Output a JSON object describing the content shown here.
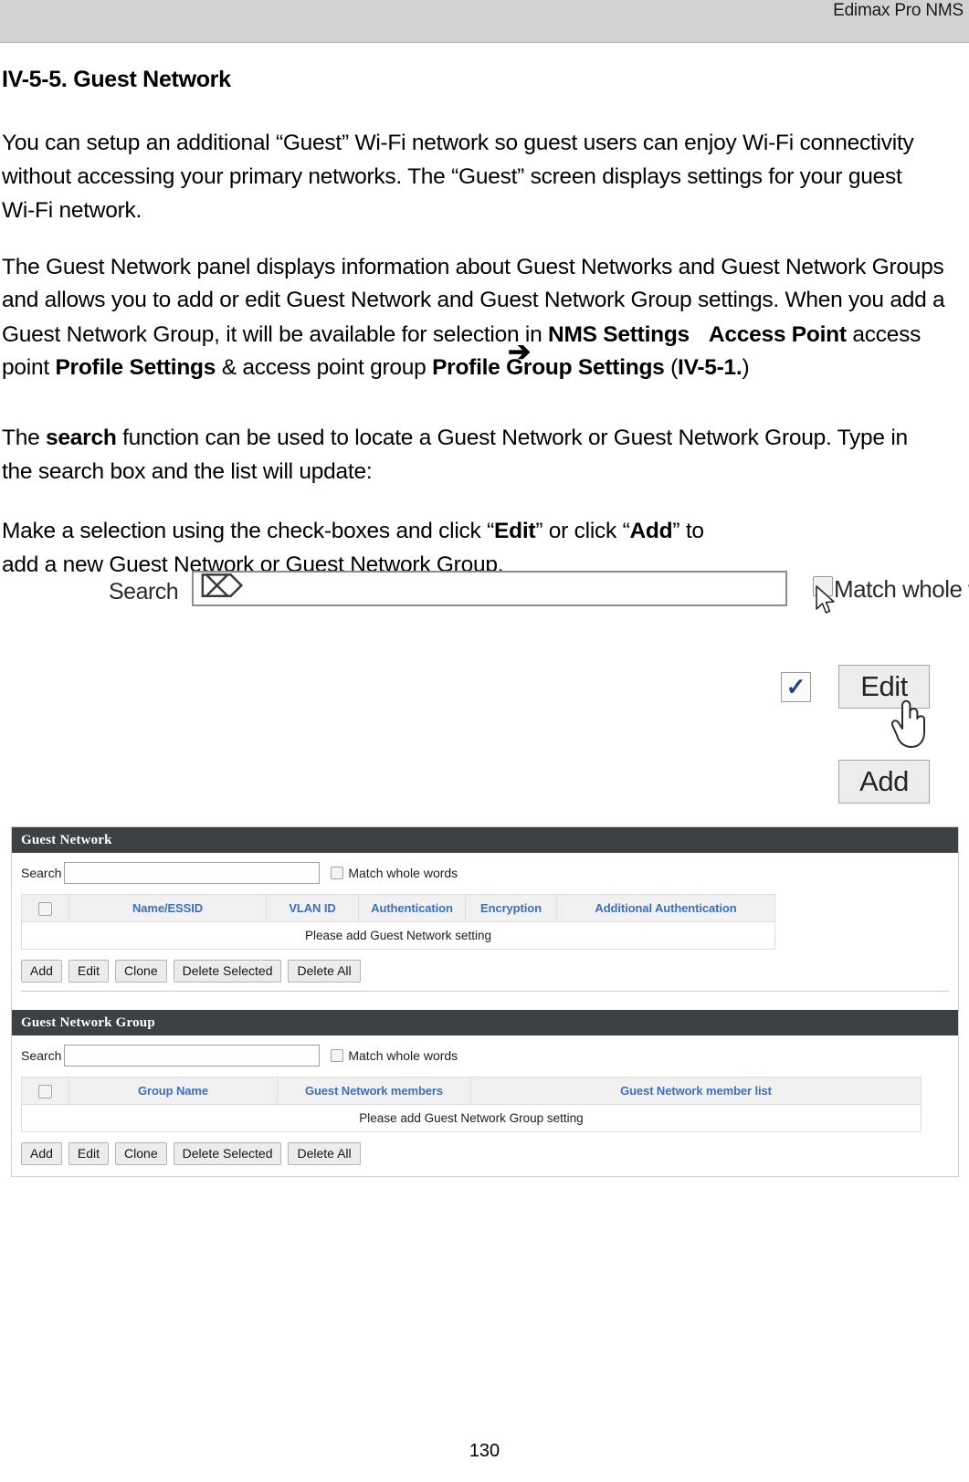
{
  "header": {
    "running_title": "Edimax Pro NMS"
  },
  "section": {
    "heading": "IV-5-5. Guest Network"
  },
  "paragraphs": {
    "p1": "You can setup an additional “Guest” Wi-Fi network so guest users can enjoy Wi-Fi connectivity without accessing your primary networks. The “Guest” screen displays settings for your guest Wi-Fi network.",
    "p2_part1": "The Guest Network panel displays information about Guest Networks and Guest Network Groups and allows you to add or edit Guest Network and Guest Network Group settings. When you add a Guest Network Group, it will be available for selection in ",
    "p2_bold1": "NMS Settings",
    "p2_arrow": "➔",
    "p2_bold2": "Access Point",
    "p2_part2": " access point ",
    "p2_bold3": "Profile Settings",
    "p2_part3": " & access point group ",
    "p2_bold4": "Profile Group Settings",
    "p2_part4": " (",
    "p2_bold5": "IV-5-1.",
    "p2_part5": ")",
    "p3_part1": "The ",
    "p3_bold1": "search",
    "p3_part2": " function can be used to locate a Guest Network or Guest Network Group. Type in the search box and the list will update:",
    "p4_part1": "Make a selection using the check-boxes and click “",
    "p4_bold1": "Edit",
    "p4_part2": "” or click “",
    "p4_bold2": "Add",
    "p4_part3": "” to add a new Guest Network or Guest Network Group."
  },
  "figure_search": {
    "search_label": "Search",
    "search_value": "",
    "search_placeholder": "",
    "match_whole_words_label": "Match whole words",
    "match_whole_words_checked": false
  },
  "figure_editadd": {
    "checkbox_checked": true,
    "checkbox_glyph": "✓",
    "edit_label": "Edit",
    "add_label": "Add"
  },
  "ui_screenshot": {
    "panels": [
      {
        "title": "Guest Network",
        "search_label": "Search",
        "search_value": "",
        "match_whole_words_label": "Match whole words",
        "match_whole_words_checked": false,
        "columns": [
          "",
          "Name/ESSID",
          "VLAN ID",
          "Authentication",
          "Encryption",
          "Additional Authentication"
        ],
        "empty_message": "Please add Guest Network setting",
        "buttons": [
          "Add",
          "Edit",
          "Clone",
          "Delete Selected",
          "Delete All"
        ]
      },
      {
        "title": "Guest Network Group",
        "search_label": "Search",
        "search_value": "",
        "match_whole_words_label": "Match whole words",
        "match_whole_words_checked": false,
        "columns": [
          "",
          "Group Name",
          "Guest Network members",
          "Guest Network member list"
        ],
        "empty_message": "Please add Guest Network Group setting",
        "buttons": [
          "Add",
          "Edit",
          "Clone",
          "Delete Selected",
          "Delete All"
        ]
      }
    ]
  },
  "footer": {
    "page_number": "130"
  },
  "colors": {
    "header_bar": "#d2d2d2",
    "panel_header": "#3d4143",
    "table_header_text": "#3f6fb5",
    "table_header_bg": "#f1f1f1"
  }
}
